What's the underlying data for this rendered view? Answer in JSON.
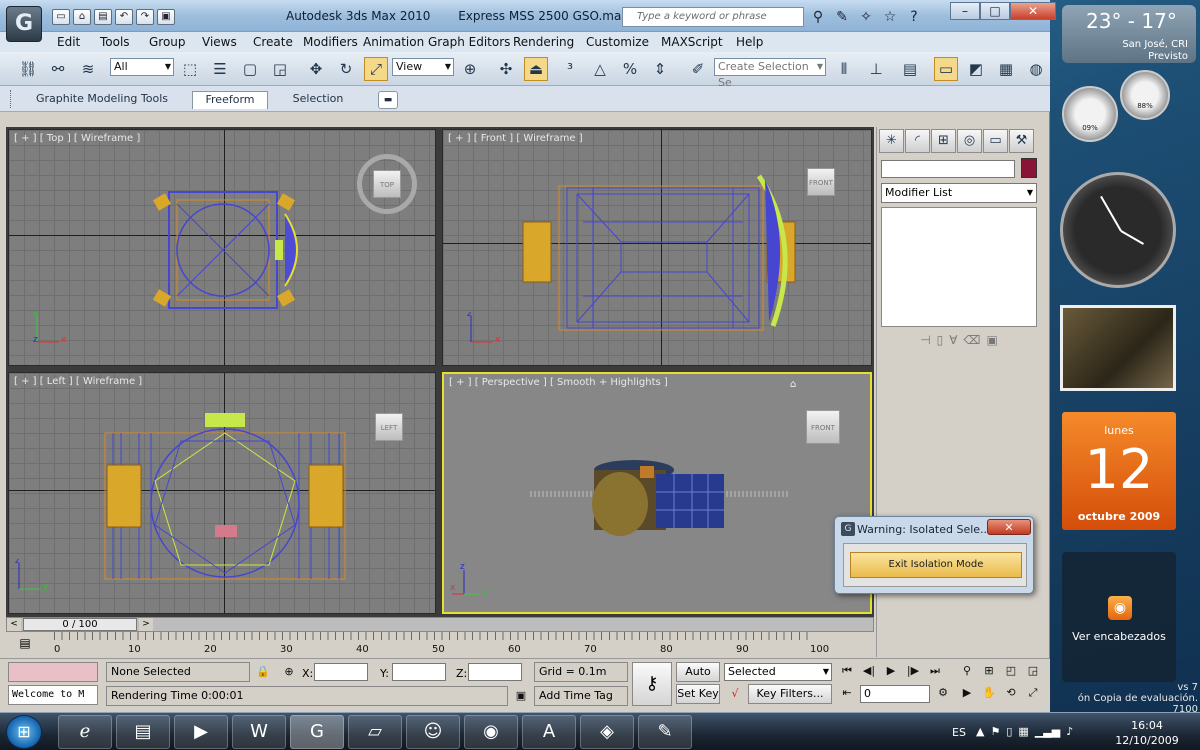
{
  "window": {
    "app_title": "Autodesk 3ds Max 2010",
    "file_title": "Express MSS 2500 GSO.max",
    "search_placeholder": "Type a keyword or phrase",
    "app_button": "G"
  },
  "menu": [
    "Edit",
    "Tools",
    "Group",
    "Views",
    "Create",
    "Modifiers",
    "Animation",
    "Graph Editors",
    "Rendering",
    "Customize",
    "MAXScript",
    "Help"
  ],
  "toolbar": {
    "selection_filter": "All",
    "reference_coord": "View",
    "named_selection": "Create Selection Se"
  },
  "ribbon": {
    "tabs": [
      "Graphite Modeling Tools",
      "Freeform",
      "Selection"
    ],
    "active_tab": "Freeform"
  },
  "viewports": [
    {
      "label": "[ + ] [ Top ] [ Wireframe ]",
      "cube": "TOP"
    },
    {
      "label": "[ + ] [ Front ] [ Wireframe ]",
      "cube": "FRONT"
    },
    {
      "label": "[ + ] [ Left ] [ Wireframe ]",
      "cube": "LEFT"
    },
    {
      "label": "[ + ] [ Perspective ] [ Smooth + Highlights ]",
      "cube": "FRONT"
    }
  ],
  "command_panel": {
    "modifier_list": "Modifier List",
    "object_color": "#8a1438"
  },
  "dialog": {
    "title": "Warning: Isolated Sele...",
    "button": "Exit Isolation Mode"
  },
  "time": {
    "frame": "0 / 100",
    "ticks": [
      "0",
      "10",
      "20",
      "30",
      "40",
      "50",
      "60",
      "70",
      "80",
      "90",
      "100"
    ]
  },
  "status": {
    "listener": "Welcome to M",
    "selection": "None Selected",
    "render_time": "Rendering Time  0:00:01",
    "x_label": "X:",
    "y_label": "Y:",
    "z_label": "Z:",
    "grid": "Grid = 0.1m",
    "add_time_tag": "Add Time Tag",
    "auto_key": "Auto Key",
    "set_key": "Set Key",
    "key_mode": "Selected",
    "key_filters": "Key Filters...",
    "current_frame": "0"
  },
  "gadgets": {
    "weather_temp": "23° - 17°",
    "weather_city": "San José, CRI",
    "weather_cond": "Previsto",
    "meter_cpu": "09%",
    "meter_mem": "88%",
    "cal_day": "lunes",
    "cal_num": "12",
    "cal_month": "octubre 2009",
    "feeds_label": "Ver encabezados"
  },
  "watermark": {
    "line1": "vs 7",
    "line2": "ón Copia de evaluación. 7100"
  },
  "taskbar": {
    "lang": "ES",
    "time": "16:04",
    "date": "12/10/2009"
  }
}
